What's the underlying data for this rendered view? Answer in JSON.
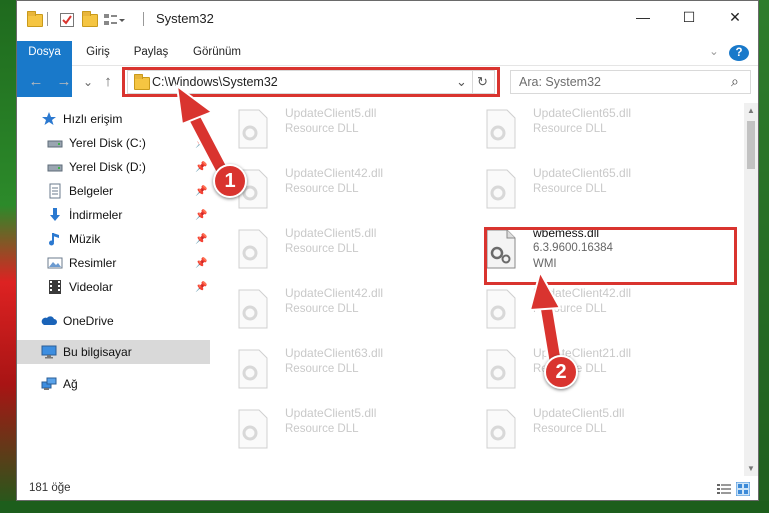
{
  "window": {
    "title": "System32",
    "buttons": {
      "minimize": "—",
      "maximize": "☐",
      "close": "✕"
    }
  },
  "ribbon": {
    "tabs": [
      "Dosya",
      "Giriş",
      "Paylaş",
      "Görünüm"
    ],
    "help": "?"
  },
  "navigation": {
    "back": "←",
    "forward": "→",
    "recent": "⌄",
    "up": "↑",
    "address": "C:\\Windows\\System32",
    "dropdown": "⌄",
    "refresh": "↻",
    "search_placeholder": "Ara: System32",
    "search_icon": "⌕"
  },
  "sidebar": {
    "items": [
      {
        "label": "Hızlı erişim",
        "icon": "star-icon",
        "pinned": false
      },
      {
        "label": "Yerel Disk (C:)",
        "icon": "drive-icon",
        "pinned": true
      },
      {
        "label": "Yerel Disk (D:)",
        "icon": "drive-icon",
        "pinned": true
      },
      {
        "label": "Belgeler",
        "icon": "documents-icon",
        "pinned": true
      },
      {
        "label": "İndirmeler",
        "icon": "download-icon",
        "pinned": true
      },
      {
        "label": "Müzik",
        "icon": "music-icon",
        "pinned": true
      },
      {
        "label": "Resimler",
        "icon": "pictures-icon",
        "pinned": true
      },
      {
        "label": "Videolar",
        "icon": "videos-icon",
        "pinned": true
      },
      {
        "label": "OneDrive",
        "icon": "cloud-icon",
        "pinned": false
      },
      {
        "label": "Bu bilgisayar",
        "icon": "computer-icon",
        "pinned": false,
        "selected": true
      },
      {
        "label": "Ağ",
        "icon": "network-icon",
        "pinned": false
      }
    ],
    "pin_glyph": "📌"
  },
  "files": [
    {
      "name": "UpdateClient5.dll",
      "desc": "Resource DLL"
    },
    {
      "name": "UpdateClient65.dll",
      "desc": "Resource DLL"
    },
    {
      "name": "UpdateClient42.dll",
      "desc": "Resource DLL"
    },
    {
      "name": "UpdateClient65.dll",
      "desc": "Resource DLL"
    },
    {
      "name": "UpdateClient5.dll",
      "desc": "Resource DLL"
    },
    {
      "name": "wbemess.dll",
      "version": "6.3.9600.16384",
      "desc": "WMI",
      "highlighted": true
    },
    {
      "name": "UpdateClient42.dll",
      "desc": "Resource DLL"
    },
    {
      "name": "UpdateClient42.dll",
      "desc": "Resource DLL"
    },
    {
      "name": "UpdateClient63.dll",
      "desc": "Resource DLL"
    },
    {
      "name": "UpdateClient21.dll",
      "desc": "Resource DLL"
    },
    {
      "name": "UpdateClient5.dll",
      "desc": "Resource DLL"
    },
    {
      "name": "UpdateClient5.dll",
      "desc": "Resource DLL"
    }
  ],
  "status": {
    "count": "181 öğe"
  },
  "annotations": {
    "badge1": "1",
    "badge2": "2"
  },
  "colors": {
    "accent": "#1979ca",
    "annotation_red": "#d9342f"
  }
}
